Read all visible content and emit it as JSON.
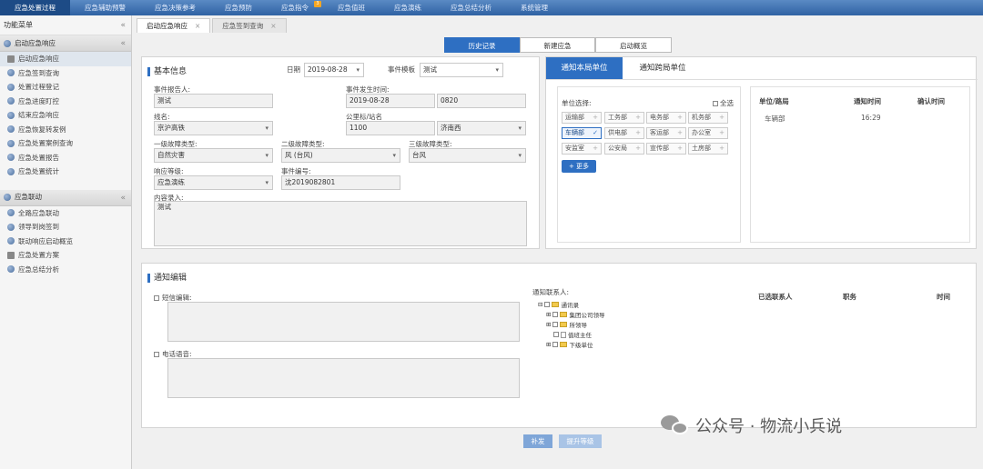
{
  "nav": {
    "tabs": [
      "应急处置过程",
      "应急辅助预警",
      "应急决策参考",
      "应急预防",
      "应急指令",
      "应急值班",
      "应急演练",
      "应急总结分析",
      "系统管理"
    ],
    "badge": "3"
  },
  "sidebar": {
    "title": "功能菜单",
    "collapse": "«",
    "group1": "启动应急响应",
    "group1_items": [
      "启动应急响应",
      "应急签到查询",
      "处置过程登记",
      "应急进度盯控",
      "结束应急响应",
      "应急恢复转发例",
      "应急处置案例查询",
      "应急处置报告",
      "应急处置统计"
    ],
    "group2": "应急联动",
    "group2_items": [
      "全路应急联动",
      "领导到岗签到",
      "联动响应启动概览",
      "应急处置方案",
      "应急总结分析"
    ]
  },
  "pagetabs": [
    {
      "label": "启动应急响应",
      "close": "×"
    },
    {
      "label": "应急签到查询",
      "close": "×"
    }
  ],
  "toggles": [
    "历史记录",
    "新建应急",
    "启动概览"
  ],
  "basic": {
    "title": "基本信息",
    "date_label": "日期",
    "date_value": "2019-08-28",
    "template_label": "事件模板",
    "template_value": "测试",
    "reporter_label": "事件报告人:",
    "reporter_value": "测试",
    "occur_label": "事件发生时间:",
    "occur_date": "2019-08-28",
    "occur_time": "0820",
    "line_label": "线名:",
    "line_value": "京沪高铁",
    "km_label": "公里标/站名",
    "km_value": "1100",
    "station_value": "济南西",
    "type1_label": "一级故障类型:",
    "type1_value": "自然灾害",
    "type2_label": "二级故障类型:",
    "type2_value": "风 (台风)",
    "type3_label": "三级故障类型:",
    "type3_value": "台风",
    "level_label": "响应等级:",
    "level_value": "应急演练",
    "code_label": "事件编号:",
    "code_value": "沈2019082801",
    "content_label": "内容录入:",
    "content_value": "测试"
  },
  "notify": {
    "tab_local": "通知本局单位",
    "tab_cross": "通知跨局单位",
    "unit_select_label": "单位选择:",
    "select_all": "全选",
    "units": [
      "运输部",
      "工务部",
      "电务部",
      "机务部",
      "车辆部",
      "供电部",
      "客运部",
      "办公室",
      "安监室",
      "公安局",
      "宣传部",
      "土房部"
    ],
    "selected_unit": "车辆部",
    "more": "+ 更多",
    "col_unit": "单位/路局",
    "col_time": "通知时间",
    "col_confirm": "确认时间",
    "row_unit": "车辆部",
    "row_time": "16:29"
  },
  "edit": {
    "title": "通知编辑",
    "sms_label": "短信编辑:",
    "voice_label": "电话语音:",
    "contacts_label": "通知联系人:",
    "tree": [
      "通讯录",
      "集团公司领导",
      "所领导",
      "值班主任",
      "下级单位"
    ],
    "col_selected": "已选联系人",
    "col_duty": "职务",
    "col_time": "时间"
  },
  "actions": {
    "supplement": "补发",
    "upgrade": "提升等级"
  },
  "watermark": "公众号 · 物流小兵说",
  "colors": {
    "primary": "#2e6fc2",
    "nav": "#2f62a3"
  }
}
